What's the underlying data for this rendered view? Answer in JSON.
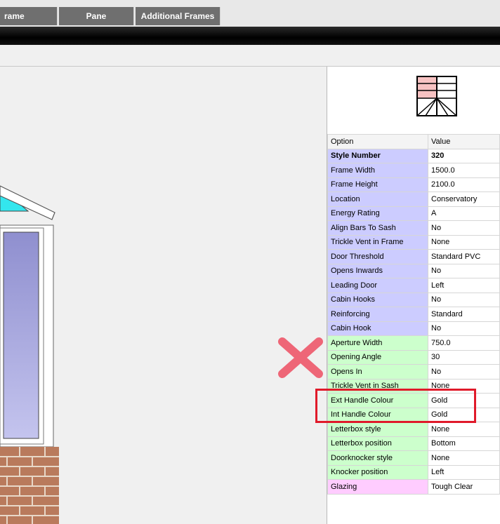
{
  "tabs": [
    {
      "label": "rame"
    },
    {
      "label": "Pane"
    },
    {
      "label": "Additional Frames"
    }
  ],
  "table": {
    "header": {
      "option": "Option",
      "value": "Value"
    },
    "rows": [
      {
        "option": "Style Number",
        "value": "320",
        "group": "blue",
        "bold": true
      },
      {
        "option": "Frame Width",
        "value": "1500.0",
        "group": "blue"
      },
      {
        "option": "Frame Height",
        "value": "2100.0",
        "group": "blue"
      },
      {
        "option": "Location",
        "value": "Conservatory",
        "group": "blue"
      },
      {
        "option": "Energy Rating",
        "value": "A",
        "group": "blue"
      },
      {
        "option": "Align Bars To Sash",
        "value": "No",
        "group": "blue"
      },
      {
        "option": "Trickle Vent in Frame",
        "value": "None",
        "group": "blue"
      },
      {
        "option": "Door Threshold",
        "value": "Standard PVC",
        "group": "blue"
      },
      {
        "option": "Opens Inwards",
        "value": "No",
        "group": "blue"
      },
      {
        "option": "Leading Door",
        "value": "Left",
        "group": "blue"
      },
      {
        "option": "Cabin Hooks",
        "value": "No",
        "group": "blue"
      },
      {
        "option": "Reinforcing",
        "value": "Standard",
        "group": "blue"
      },
      {
        "option": "Cabin Hook",
        "value": "No",
        "group": "blue"
      },
      {
        "option": "Aperture Width",
        "value": "750.0",
        "group": "green"
      },
      {
        "option": "Opening Angle",
        "value": "30",
        "group": "green"
      },
      {
        "option": "Opens In",
        "value": "No",
        "group": "green"
      },
      {
        "option": "Trickle Vent in Sash",
        "value": "None",
        "group": "green"
      },
      {
        "option": "Ext Handle Colour",
        "value": "Gold",
        "group": "green"
      },
      {
        "option": "Int Handle Colour",
        "value": "Gold",
        "group": "green"
      },
      {
        "option": "Letterbox style",
        "value": "None",
        "group": "green"
      },
      {
        "option": "Letterbox position",
        "value": "Bottom",
        "group": "green"
      },
      {
        "option": "Doorknocker style",
        "value": "None",
        "group": "green"
      },
      {
        "option": "Knocker position",
        "value": "Left",
        "group": "green"
      },
      {
        "option": "Glazing",
        "value": "Tough Clear",
        "group": "pink"
      }
    ]
  },
  "colors": {
    "option_blue": "#ccccff",
    "option_green": "#ccffcc",
    "option_pink": "#ffccff",
    "highlight": "#e01a2a",
    "x_mark": "#ee6677"
  },
  "icons": {
    "preview": "door-style-preview-icon",
    "mark": "x-mark-icon"
  }
}
